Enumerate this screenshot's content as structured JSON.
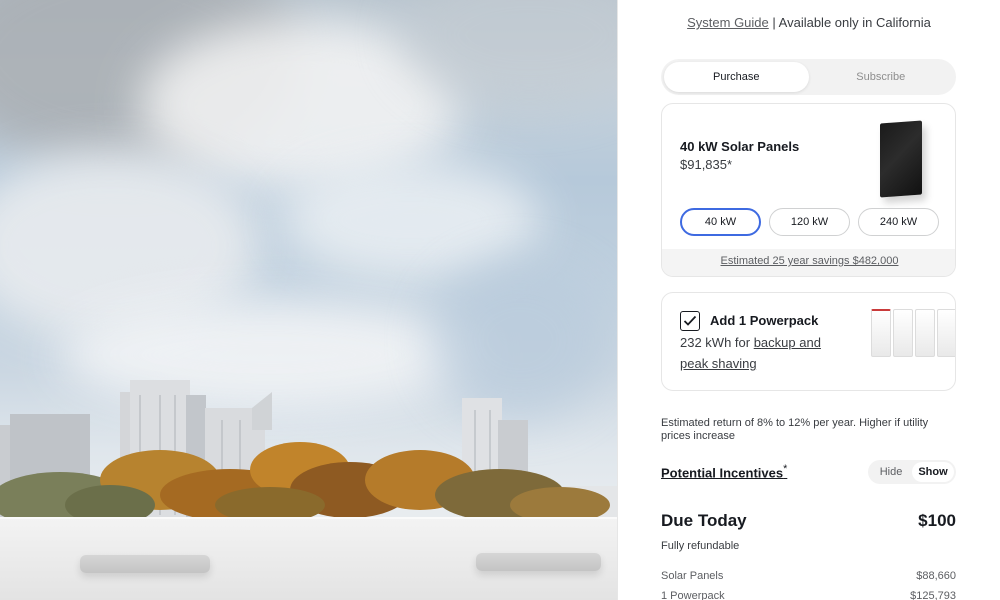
{
  "header": {
    "guide_link": "System Guide",
    "availability": " | Available only in California"
  },
  "tabs": [
    {
      "label": "Purchase",
      "active": true
    },
    {
      "label": "Subscribe",
      "active": false
    }
  ],
  "solar": {
    "title": "40 kW Solar Panels",
    "price": "$91,835*",
    "sizes": [
      {
        "label": "40 kW",
        "selected": true
      },
      {
        "label": "120 kW",
        "selected": false
      },
      {
        "label": "240 kW",
        "selected": false
      }
    ],
    "savings": "Estimated 25 year savings $482,000"
  },
  "powerpack": {
    "checked": true,
    "title": "Add 1 Powerpack",
    "desc_prefix": "232 kWh for ",
    "desc_link": "backup and peak shaving"
  },
  "return_note": "Estimated return of 8% to 12% per year. Higher if utility prices increase",
  "incentives": {
    "label": "Potential Incentives",
    "asterisk": "*",
    "toggle": [
      {
        "label": "Hide",
        "on": false
      },
      {
        "label": "Show",
        "on": true
      }
    ]
  },
  "due": {
    "label": "Due Today",
    "amount": "$100",
    "note": "Fully refundable"
  },
  "line_items": [
    {
      "label": "Solar Panels",
      "value": "$88,660"
    },
    {
      "label": "1 Powerpack",
      "value": "$125,793"
    }
  ],
  "colors": {
    "accent": "#3e6ae1",
    "text": "#171a20",
    "muted": "#5c5e62"
  }
}
